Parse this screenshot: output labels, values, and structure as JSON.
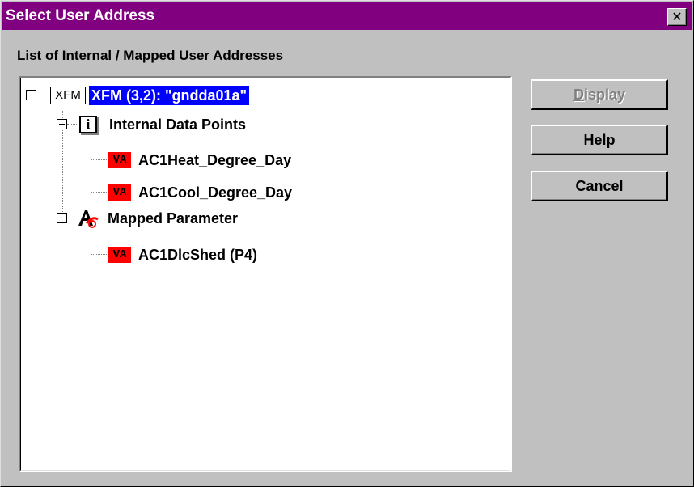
{
  "window": {
    "title": "Select User Address",
    "close_glyph": "✕"
  },
  "list_label": "List of Internal / Mapped User Addresses",
  "tree": {
    "root": {
      "icon": "xfm-icon",
      "icon_text": "XFM",
      "label": "XFM (3,2): \"gndda01a\"",
      "selected": true
    },
    "internal": {
      "icon": "info-icon",
      "icon_text": "i",
      "label": "Internal Data Points",
      "children": [
        {
          "icon": "va-icon",
          "icon_text": "VA",
          "label": "AC1Heat_Degree_Day"
        },
        {
          "icon": "va-icon",
          "icon_text": "VA",
          "label": "AC1Cool_Degree_Day"
        }
      ]
    },
    "mapped": {
      "icon": "mapped-parameter-icon",
      "label": "Mapped Parameter",
      "children": [
        {
          "icon": "va-icon",
          "icon_text": "VA",
          "label": "AC1DlcShed (P4)"
        }
      ]
    }
  },
  "buttons": {
    "display": {
      "accel": "D",
      "rest": "isplay",
      "enabled": false
    },
    "help": {
      "accel": "H",
      "rest": "elp",
      "enabled": true
    },
    "cancel": {
      "label": "Cancel",
      "enabled": true
    }
  },
  "colors": {
    "titlebar": "#800080",
    "selection": "#0000ff",
    "va_badge": "#ff0000",
    "face": "#c0c0c0"
  }
}
